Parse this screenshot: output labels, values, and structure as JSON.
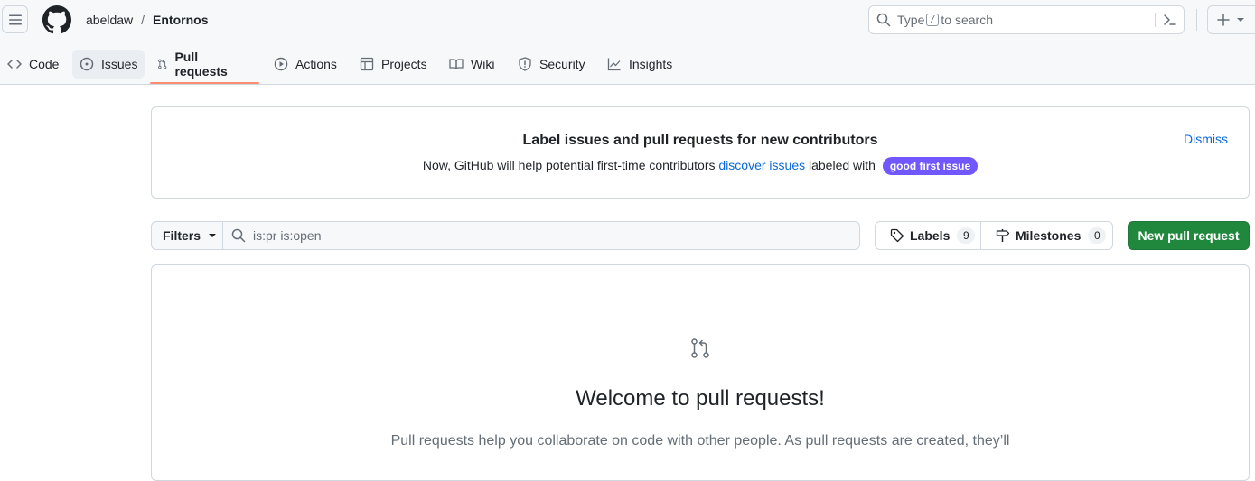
{
  "header": {
    "owner": "abeldaw",
    "separator": "/",
    "repo": "Entornos",
    "search_prefix": "Type",
    "search_key": "/",
    "search_suffix": "to search"
  },
  "tabs": [
    {
      "label": "Code",
      "icon": "code-icon"
    },
    {
      "label": "Issues",
      "icon": "issue-icon"
    },
    {
      "label": "Pull requests",
      "icon": "pull-request-icon"
    },
    {
      "label": "Actions",
      "icon": "play-icon"
    },
    {
      "label": "Projects",
      "icon": "table-icon"
    },
    {
      "label": "Wiki",
      "icon": "book-icon"
    },
    {
      "label": "Security",
      "icon": "shield-icon"
    },
    {
      "label": "Insights",
      "icon": "graph-icon"
    }
  ],
  "banner": {
    "title": "Label issues and pull requests for new contributors",
    "text_before": "Now, GitHub will help potential first-time contributors ",
    "link": "discover issues ",
    "text_after": "labeled with",
    "label": "good first issue",
    "dismiss": "Dismiss"
  },
  "toolbar": {
    "filters": "Filters",
    "query": "is:pr is:open",
    "labels": "Labels",
    "labels_count": "9",
    "milestones": "Milestones",
    "milestones_count": "0",
    "new_pr": "New pull request"
  },
  "blankslate": {
    "title": "Welcome to pull requests!",
    "text": "Pull requests help you collaborate on code with other people. As pull requests are created, they’ll"
  },
  "colors": {
    "accent": "#0969da",
    "primary_button": "#1f883d",
    "tab_underline": "#fd8c73",
    "label_pill": "#7057ff"
  }
}
